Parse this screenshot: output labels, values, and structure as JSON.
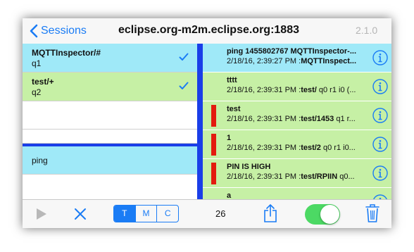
{
  "nav": {
    "back_label": "Sessions",
    "title": "eclipse.org-m2m.eclipse.org:1883",
    "version": "2.1.0"
  },
  "subscriptions": [
    {
      "topic": "MQTTInspector/#",
      "qos": "q1",
      "checked": true,
      "bg": "#9fe9f8"
    },
    {
      "topic": "test/+",
      "qos": "q2",
      "checked": true,
      "bg": "#c6f0a5"
    }
  ],
  "publications": [
    {
      "text": "ping",
      "bg": "#9fe9f8"
    }
  ],
  "messages": [
    {
      "title": "ping 1455802767 MQTTInspector-...",
      "date": "2/18/16, 2:39:27 PM :",
      "topic": "MQTTInspect...",
      "rest": "",
      "marker": false,
      "bg": "#9fe9f8"
    },
    {
      "title": "tttt",
      "date": "2/18/16, 2:39:31 PM :",
      "topic": "test/",
      "rest": " q0 r1 i0 (...",
      "marker": false,
      "bg": "#c6f0a5"
    },
    {
      "title": "test",
      "date": "2/18/16, 2:39:31 PM :",
      "topic": "test/1453",
      "rest": " q1 r...",
      "marker": true,
      "bg": "#c6f0a5"
    },
    {
      "title": "1",
      "date": "2/18/16, 2:39:31 PM :",
      "topic": "test/2",
      "rest": " q0 r1 i0...",
      "marker": true,
      "bg": "#c6f0a5"
    },
    {
      "title": "PIN IS HIGH",
      "date": "2/18/16, 2:39:31 PM :",
      "topic": "test/RPIIN",
      "rest": " q0...",
      "marker": true,
      "bg": "#c6f0a5"
    },
    {
      "title": "a",
      "date": "",
      "topic": "",
      "rest": "",
      "marker": false,
      "bg": "#c6f0a5"
    }
  ],
  "toolbar": {
    "segments": [
      "T",
      "M",
      "C"
    ],
    "active_segment": "T",
    "count": "26",
    "toggle_on": true
  },
  "icons": {
    "back": "chevron-left-icon",
    "check": "checkmark-icon",
    "info": "info-circle-icon",
    "play": "play-icon",
    "clear": "close-x-icon",
    "share": "share-icon",
    "trash": "trash-icon"
  },
  "colors": {
    "accent": "#1a7cf5",
    "divider": "#1a3ee8",
    "retained_marker": "#e31b0f",
    "cyan_row": "#9fe9f8",
    "green_row": "#c6f0a5",
    "toggle_on": "#4cd964"
  }
}
